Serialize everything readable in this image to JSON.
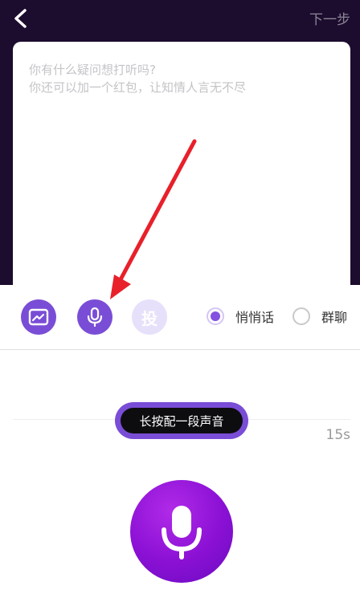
{
  "header": {
    "back_icon": "chevron-left-icon",
    "next_label": "下一步"
  },
  "editor": {
    "placeholder_line1": "你有什么疑问想打听吗?",
    "placeholder_line2": "你还可以加一个红包，让知情人言无不尽"
  },
  "toolbar": {
    "image_icon": "image-icon",
    "mic_icon": "microphone-icon",
    "vote_label": "投",
    "options": [
      {
        "label": "悄悄话",
        "selected": true
      },
      {
        "label": "群聊",
        "selected": false
      }
    ]
  },
  "recorder": {
    "hold_label": "长按配一段声音",
    "duration": "15s",
    "record_icon": "microphone-icon"
  },
  "colors": {
    "accent": "#7a4dd6",
    "dark_header": "#1c0c2e",
    "annotation_arrow": "#e8202a"
  }
}
